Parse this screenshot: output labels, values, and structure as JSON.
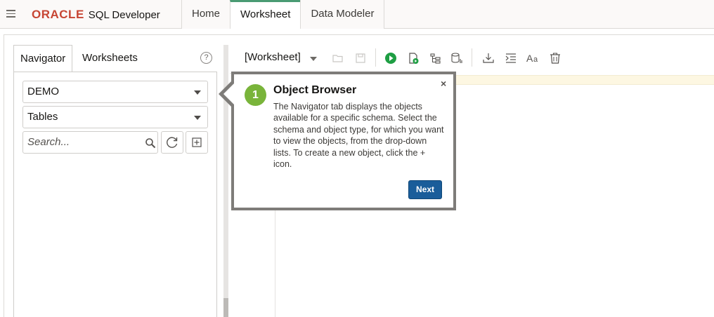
{
  "app": {
    "brand": "ORACLE",
    "product": "SQL Developer",
    "colors": {
      "brand_red": "#c74634",
      "active_tab_accent": "#4a9b73",
      "step_badge": "#79b43a",
      "next_button": "#1a5d9a"
    }
  },
  "top_tabs": [
    {
      "label": "Home",
      "active": false
    },
    {
      "label": "Worksheet",
      "active": true
    },
    {
      "label": "Data Modeler",
      "active": false
    }
  ],
  "left_tabs": [
    {
      "label": "Navigator",
      "active": true
    },
    {
      "label": "Worksheets",
      "active": false
    }
  ],
  "help_icon_glyph": "?",
  "navigator": {
    "schema_value": "DEMO",
    "object_type_value": "Tables",
    "search_placeholder": "Search..."
  },
  "editor": {
    "worksheet_selector": "[Worksheet]"
  },
  "popover": {
    "step_number": "1",
    "title": "Object Browser",
    "body": "The Navigator tab displays the objects available for a specific schema. Select the schema and object type, for which you want to view the objects, from the drop-down lists. To create a new object, click the + icon.",
    "close_glyph": "×",
    "next_label": "Next"
  }
}
